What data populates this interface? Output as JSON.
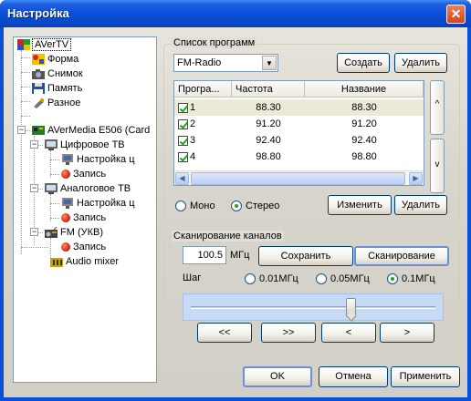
{
  "window": {
    "title": "Настройка",
    "close_glyph": "✕"
  },
  "tree": {
    "items": [
      {
        "label": "AVerTV",
        "icon": "avertv-logo-icon"
      },
      {
        "label": "Форма",
        "icon": "form-icon"
      },
      {
        "label": "Снимок",
        "icon": "camera-icon"
      },
      {
        "label": "Память",
        "icon": "floppy-icon"
      },
      {
        "label": "Разное",
        "icon": "misc-icon"
      },
      {
        "label": "AVerMedia E506 (Card",
        "icon": "card-icon",
        "expander": "−"
      },
      {
        "label": "Цифровое ТВ",
        "icon": "tv-icon",
        "expander": "−"
      },
      {
        "label": "Настройка ц",
        "icon": "monitor-icon"
      },
      {
        "label": "Запись",
        "icon": "record-icon"
      },
      {
        "label": "Аналоговое ТВ",
        "icon": "tv-icon",
        "expander": "−"
      },
      {
        "label": "Настройка ц",
        "icon": "monitor-icon"
      },
      {
        "label": "Запись",
        "icon": "record-icon"
      },
      {
        "label": "FM (УКВ)",
        "icon": "radio-icon",
        "expander": "−"
      },
      {
        "label": "Запись",
        "icon": "record-icon"
      },
      {
        "label": "Audio mixer",
        "icon": "mixer-icon"
      }
    ]
  },
  "programs": {
    "group_title": "Список программ",
    "source": "FM-Radio",
    "create_label": "Создать",
    "delete_label": "Удалить",
    "columns": [
      "Програ...",
      "Частота",
      "Название"
    ],
    "rows": [
      {
        "num": "1",
        "freq": "88.30",
        "name": "88.30"
      },
      {
        "num": "2",
        "freq": "91.20",
        "name": "91.20"
      },
      {
        "num": "3",
        "freq": "92.40",
        "name": "92.40"
      },
      {
        "num": "4",
        "freq": "98.80",
        "name": "98.80"
      }
    ],
    "up_glyph": "^",
    "down_glyph": "v",
    "scroll_left": "◀",
    "scroll_right": "▶",
    "mono_label": "Моно",
    "stereo_label": "Стерео",
    "mode_selected": "Стерео",
    "edit_label": "Изменить",
    "delete2_label": "Удалить"
  },
  "scan": {
    "group_title": "Сканирование каналов",
    "frequency": "100.5",
    "unit": "МГц",
    "save_label": "Сохранить",
    "scan_label": "Сканирование",
    "step_label": "Шаг",
    "steps": [
      "0.01МГц",
      "0.05МГц",
      "0.1МГц"
    ],
    "step_selected": "0.1МГц",
    "slider_position": 0.66,
    "nav": [
      "<<",
      ">>",
      "<",
      ">"
    ]
  },
  "footer": {
    "ok_label": "OK",
    "cancel_label": "Отмена",
    "apply_label": "Применить"
  },
  "colors": {
    "accent": "#0a4fd8",
    "check": "#21a121",
    "close": "#d4431c"
  }
}
